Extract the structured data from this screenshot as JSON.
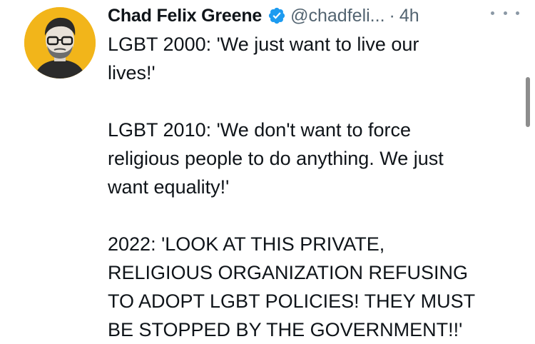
{
  "tweet": {
    "author": {
      "display_name": "Chad Felix Greene",
      "handle": "@chadfeli...",
      "verified": true
    },
    "separator": "·",
    "timestamp": "4h",
    "lines": {
      "l1": "LGBT 2000: 'We just want to live our",
      "l2": "lives!'",
      "l3": "LGBT 2010: 'We don't want to force",
      "l4": "religious people to do anything. We just",
      "l5": "want equality!'",
      "l6": "2022: 'LOOK AT THIS PRIVATE,",
      "l7": "RELIGIOUS ORGANIZATION REFUSING",
      "l8": "TO ADOPT LGBT POLICIES! THEY MUST",
      "l9": "BE STOPPED BY THE GOVERNMENT!!'"
    }
  },
  "icons": {
    "verified": "verified-badge-icon",
    "more": "more-options-icon"
  },
  "colors": {
    "text_primary": "#0f1419",
    "text_secondary": "#536471",
    "verified_blue": "#1d9bf0",
    "avatar_bg": "#f2b51a"
  }
}
